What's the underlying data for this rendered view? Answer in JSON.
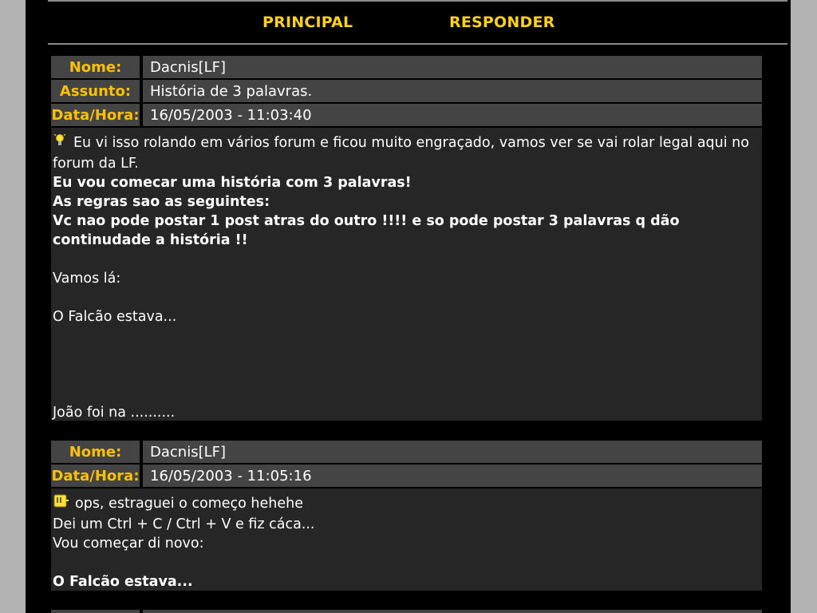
{
  "nav": {
    "principal": "PRINCIPAL",
    "responder": "RESPONDER"
  },
  "labels": {
    "nome": "Nome:",
    "assunto": "Assunto:",
    "data_hora": "Data/Hora:"
  },
  "posts": [
    {
      "author": "Dacnis[LF]",
      "subject": "História de 3 palavras.",
      "datetime": "16/05/2003 - 11:03:40",
      "icon": "lightbulb-icon",
      "lines": {
        "l1": "Eu vi isso rolando em vários forum e ficou muito engraçado, vamos ver se vai rolar legal aqui no forum da LF.",
        "l2": "Eu vou comecar uma história com 3 palavras!",
        "l3": "As regras sao as seguintes:",
        "l4": "Vc nao pode postar 1 post atras do outro !!!! e so pode postar 3 palavras q dão continudade a história !!",
        "l5": "Vamos lá:",
        "l6": "O Falcão estava...",
        "l7": "João foi na .........."
      }
    },
    {
      "author": "Dacnis[LF]",
      "datetime": "16/05/2003 - 11:05:16",
      "icon": "embarrassed-face-icon",
      "lines": {
        "l1": "ops, estraguei o começo hehehe",
        "l2": "Dei um Ctrl + C / Ctrl + V e fiz cáca...",
        "l3": "Vou começar di novo:",
        "l4": "O Falcão estava..."
      }
    }
  ],
  "colors": {
    "accent": "#ffd21a",
    "label_bg": "#444444",
    "body_bg": "#262626",
    "page_bg": "#000000",
    "outer_bg": "#b3b3b3"
  }
}
